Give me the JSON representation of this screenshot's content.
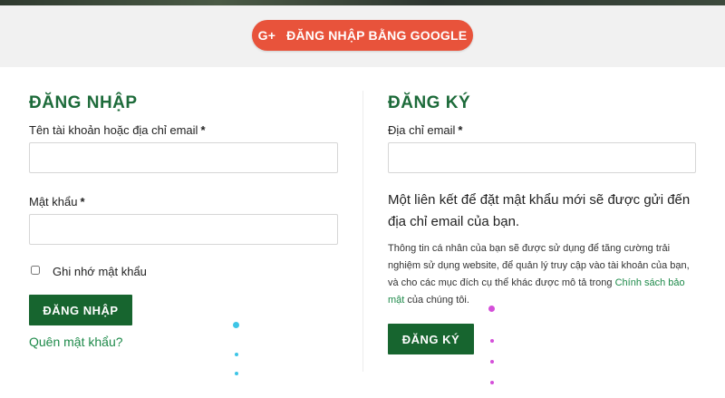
{
  "social": {
    "google_icon": "G+",
    "google_label": "ĐĂNG NHẬP BẰNG GOOGLE"
  },
  "login": {
    "heading": "ĐĂNG NHẬP",
    "username_label": "Tên tài khoản hoặc địa chỉ email",
    "password_label": "Mật khẩu",
    "required_mark": "*",
    "username_value": "",
    "password_value": "",
    "remember_label": "Ghi nhớ mật khẩu",
    "submit_label": "ĐĂNG NHẬP",
    "forgot_link": "Quên mật khẩu?"
  },
  "register": {
    "heading": "ĐĂNG KÝ",
    "email_label": "Địa chỉ email",
    "required_mark": "*",
    "email_value": "",
    "info_text": "Một liên kết để đặt mật khẩu mới sẽ được gửi đến địa chỉ email của bạn.",
    "privacy_before": "Thông tin cá nhân của bạn sẽ được sử dụng để tăng cường trải nghiệm sử dụng website, để quản lý truy cập vào tài khoản của bạn, và cho các mục đích cụ thể khác được mô tả trong ",
    "privacy_link": "Chính sách bảo mật",
    "privacy_after": " của chúng tôi.",
    "submit_label": "ĐĂNG KÝ"
  },
  "colors": {
    "google_red": "#e8533b",
    "brand_green": "#17652f",
    "heading_green": "#1d6b3a",
    "link_green": "#1e8a4a"
  }
}
